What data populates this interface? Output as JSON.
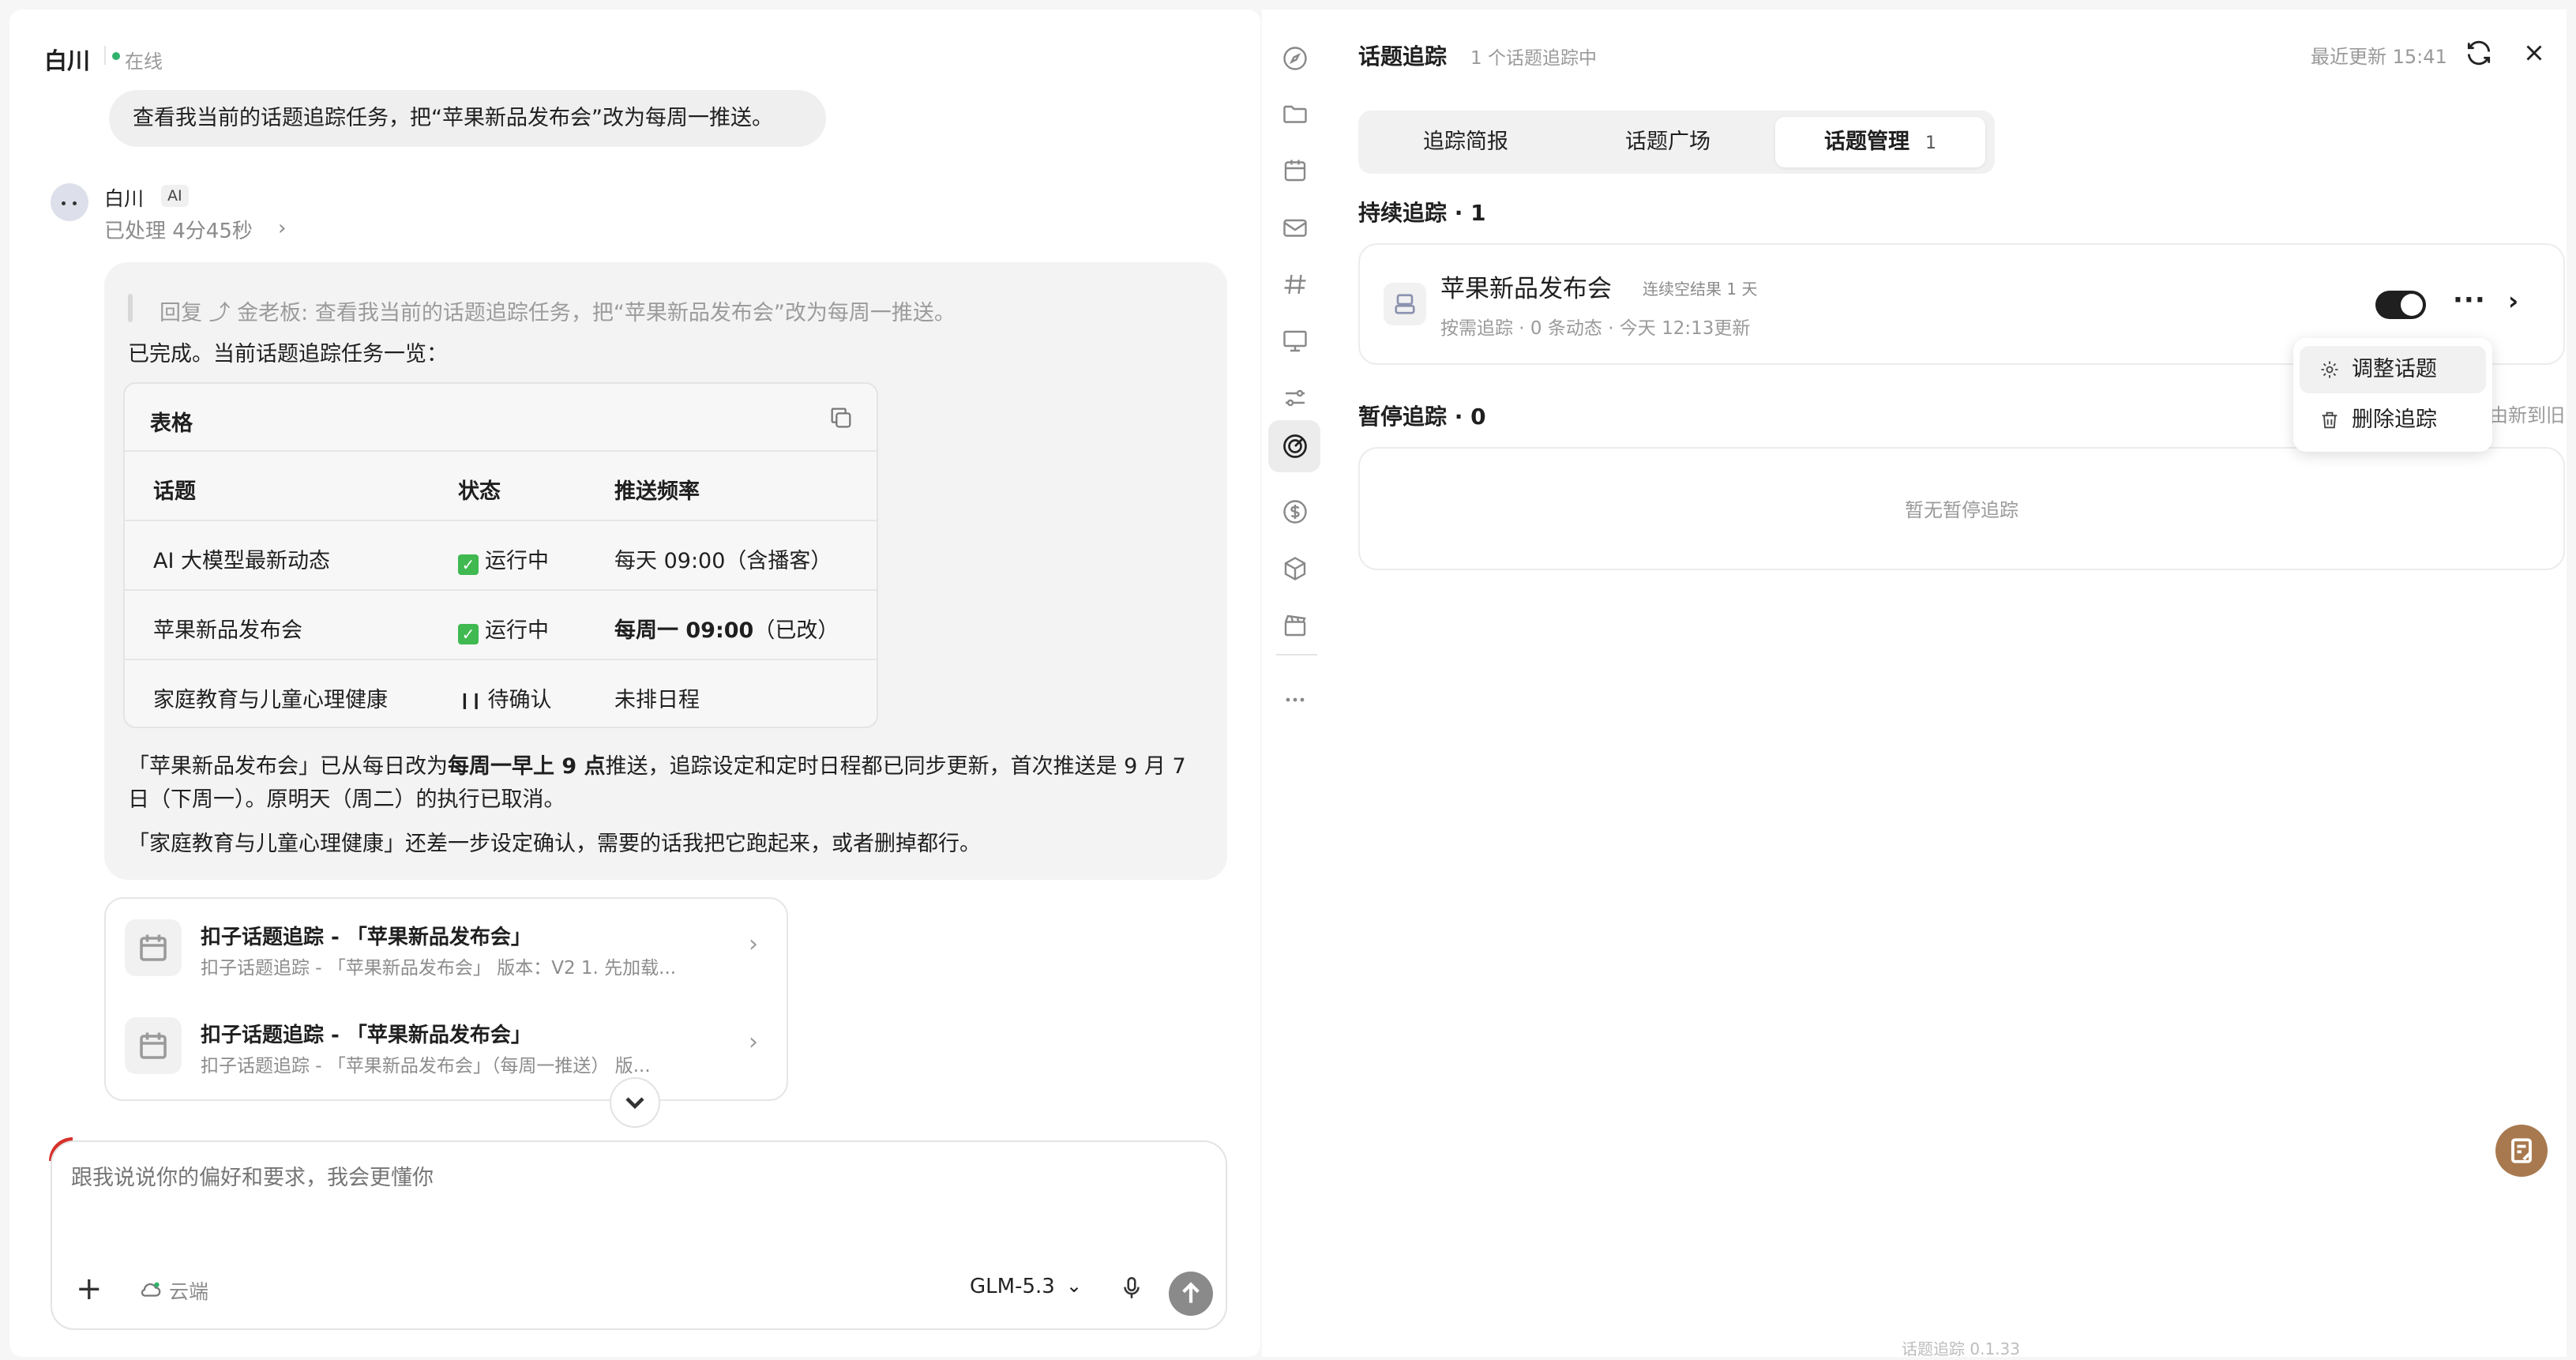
{
  "header": {
    "name": "白川",
    "status": "在线"
  },
  "user_message": "查看我当前的话题追踪任务，把“苹果新品发布会”改为每周一推送。",
  "ai": {
    "name": "白川",
    "badge": "AI",
    "processed": "已处理 4分45秒",
    "quote": "回复 ⤴ 金老板:  查看我当前的话题追踪任务，把“苹果新品发布会”改为每周一推送。",
    "done": "已完成。当前话题追踪任务一览：",
    "table": {
      "title": "表格",
      "headers": [
        "话题",
        "状态",
        "推送频率"
      ],
      "rows": [
        {
          "topic": "AI 大模型最新动态",
          "status": "运行中",
          "status_icon": "check",
          "freq": "每天 09:00（含播客）",
          "freq_bold": "",
          "freq_tail": ""
        },
        {
          "topic": "苹果新品发布会",
          "status": "运行中",
          "status_icon": "check",
          "freq": "",
          "freq_bold": "每周一 09:00",
          "freq_tail": "（已改）"
        },
        {
          "topic": "家庭教育与儿童心理健康",
          "status": "待确认",
          "status_icon": "pause",
          "freq": "未排日程",
          "freq_bold": "",
          "freq_tail": ""
        }
      ]
    },
    "para1_a": "「苹果新品发布会」已从每日改为",
    "para1_bold": "每周一早上 9 点",
    "para1_b": "推送，追踪设定和定时日程都已同步更新，首次推送是 9 月 7 日（下周一）。原明天（周二）的执行已取消。",
    "para2": "「家庭教育与儿童心理健康」还差一步设定确认，需要的话我把它跑起来，或者删掉都行。"
  },
  "schedules": [
    {
      "title": "扣子话题追踪 - 「苹果新品发布会」",
      "subtitle": "扣子话题追踪 - 「苹果新品发布会」 版本：V2 1. 先加载..."
    },
    {
      "title": "扣子话题追踪 - 「苹果新品发布会」",
      "subtitle": "扣子话题追踪 - 「苹果新品发布会」（每周一推送） 版..."
    }
  ],
  "composer": {
    "placeholder": "跟我说说你的偏好和要求，我会更懂你",
    "cloud_label": "云端",
    "model": "GLM-5.3"
  },
  "panel": {
    "title": "话题追踪",
    "count": "1 个话题追踪中",
    "updated": "最近更新 15:41",
    "tabs": [
      {
        "label": "追踪简报"
      },
      {
        "label": "话题广场"
      },
      {
        "label": "话题管理",
        "badge": "1"
      }
    ],
    "active_section": "持续追踪 · 1",
    "topic": {
      "name": "苹果新品发布会",
      "tag": "连续空结果 1 天",
      "meta": "按需追踪 · 0 条动态 · 今天 12:13更新",
      "enabled": true
    },
    "paused_section": "暂停追踪 · 0",
    "sort_label": "由新到旧",
    "empty_text": "暂无暂停追踪",
    "menu": [
      {
        "label": "调整话题",
        "icon": "gear-icon"
      },
      {
        "label": "删除追踪",
        "icon": "trash-icon"
      }
    ],
    "version": "话题追踪 0.1.33"
  },
  "colors": {
    "online": "#2fb36b",
    "check": "#3fb950",
    "fab": "#a8794f"
  }
}
